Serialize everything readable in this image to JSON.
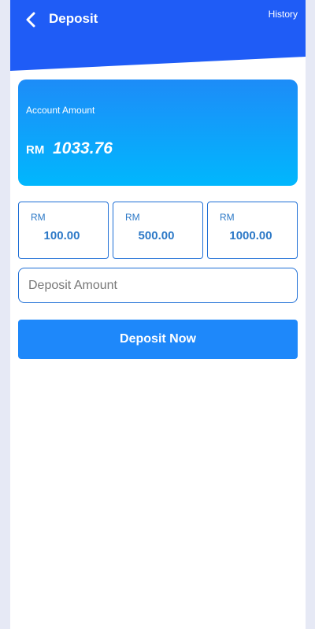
{
  "header": {
    "title": "Deposit",
    "history_label": "History",
    "back_icon": "chevron-left-icon"
  },
  "balance": {
    "label": "Account Amount",
    "currency": "RM",
    "value": "1033.76"
  },
  "presets": [
    {
      "currency": "RM",
      "value": "100.00"
    },
    {
      "currency": "RM",
      "value": "500.00"
    },
    {
      "currency": "RM",
      "value": "1000.00"
    }
  ],
  "amount_input": {
    "value": "",
    "placeholder": "Deposit Amount"
  },
  "submit_label": "Deposit Now",
  "colors": {
    "header_bg": "#1f5cf6",
    "card_gradient_top": "#1d8cf8",
    "card_gradient_bottom": "#01b7fd",
    "accent_text": "#2d79c7",
    "border": "#1f6fd6",
    "button_bg": "#1e88fa",
    "page_bg": "#e6e9f5"
  }
}
